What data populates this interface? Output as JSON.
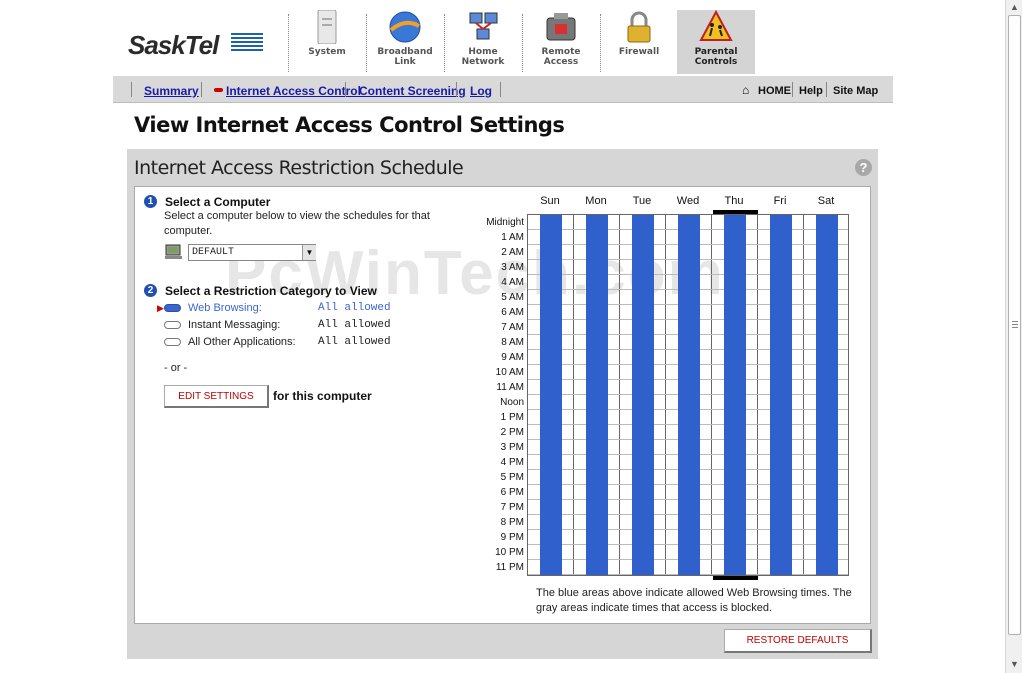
{
  "brand": {
    "logo_text": "SaskTel"
  },
  "top_tabs": [
    {
      "label_1": "System",
      "label_2": ""
    },
    {
      "label_1": "Broadband",
      "label_2": "Link"
    },
    {
      "label_1": "Home",
      "label_2": "Network"
    },
    {
      "label_1": "Remote",
      "label_2": "Access"
    },
    {
      "label_1": "Firewall",
      "label_2": ""
    },
    {
      "label_1": "Parental",
      "label_2": "Controls"
    }
  ],
  "subnav": {
    "summary": "Summary",
    "internet_access_control": "Internet Access Control",
    "content_screening": "Content Screening",
    "log": "Log",
    "home": "HOME",
    "help": "Help",
    "site_map": "Site Map"
  },
  "page_title": "View Internet Access Control Settings",
  "panel_title": "Internet Access Restriction Schedule",
  "help_icon": "?",
  "step1": {
    "number": "1",
    "title": "Select a Computer",
    "desc_line1": "Select a computer below to view the schedules for that",
    "desc_line2": "computer.",
    "selected_computer": "DEFAULT"
  },
  "step2": {
    "number": "2",
    "title": "Select a Restriction Category to View",
    "categories": [
      {
        "label": "Web Browsing:",
        "value": "All allowed"
      },
      {
        "label": "Instant Messaging:",
        "value": "All allowed"
      },
      {
        "label": "All Other Applications:",
        "value": "All allowed"
      }
    ]
  },
  "or_text": "- or -",
  "edit_button": "EDIT SETTINGS",
  "edit_suffix": "for this computer",
  "days": [
    "Sun",
    "Mon",
    "Tue",
    "Wed",
    "Thu",
    "Fri",
    "Sat"
  ],
  "hours": [
    "Midnight",
    "1 AM",
    "2 AM",
    "3 AM",
    "4 AM",
    "5 AM",
    "6 AM",
    "7 AM",
    "8 AM",
    "9 AM",
    "10 AM",
    "11 AM",
    "Noon",
    "1 PM",
    "2 PM",
    "3 PM",
    "4 PM",
    "5 PM",
    "6 PM",
    "7 PM",
    "8 PM",
    "9 PM",
    "10 PM",
    "11 PM"
  ],
  "legend_line1": "The blue areas above indicate allowed Web Browsing times. The",
  "legend_line2": "gray areas indicate times that access is blocked.",
  "restore_button": "RESTORE DEFAULTS",
  "watermark": "PcWinTech.com",
  "colors": {
    "allowed": "#3060cc",
    "brand_blue": "#1f5fb0",
    "button_text": "#c00000"
  }
}
